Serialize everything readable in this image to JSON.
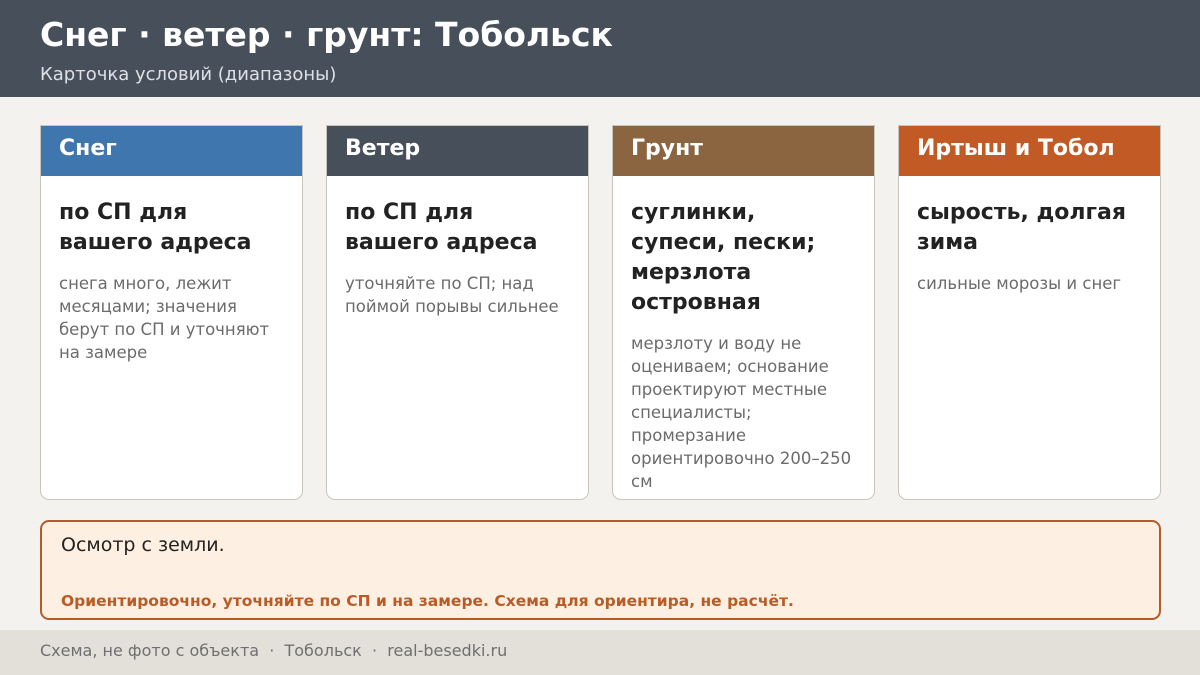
{
  "header": {
    "title": "Снег · ветер · грунт: Тобольск",
    "subtitle": "Карточка условий (диапазоны)"
  },
  "cards": [
    {
      "heading": "Снег",
      "color": "#3f76ad",
      "main": "по СП для вашего адреса",
      "note": "снега много, лежит месяцами; значения берут по СП и уточняют на замере"
    },
    {
      "heading": "Ветер",
      "color": "#474f5b",
      "main": "по СП для вашего адреса",
      "note": "уточняйте по СП; над поймой порывы сильнее"
    },
    {
      "heading": "Грунт",
      "color": "#8a653f",
      "main": "суглинки, супеси, пески; мерзлота островная",
      "note": "мерзлоту и воду не оцениваем; основание проектируют местные специалисты; промерзание ориентировочно 200–250 см"
    },
    {
      "heading": "Иртыш и Тобол",
      "color": "#c25a25",
      "main": "сырость, долгая зима",
      "note": "сильные морозы и снег"
    }
  ],
  "notice": {
    "text": "Осмотр с земли.",
    "warning": "Ориентировочно, уточняйте по СП и на замере. Схема для ориентира, не расчёт."
  },
  "footer": {
    "text": "Схема, не фото с объекта  ·  Тобольск  ·  real-besedki.ru"
  }
}
